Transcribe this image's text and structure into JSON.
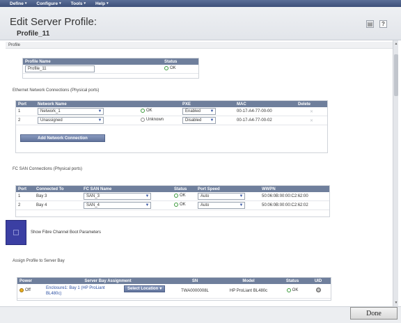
{
  "menu": [
    {
      "label": "Define"
    },
    {
      "label": "Configure"
    },
    {
      "label": "Tools"
    },
    {
      "label": "Help"
    }
  ],
  "header": {
    "title": "Edit Server Profile:",
    "subtitle": "Profile_11"
  },
  "profile": {
    "section_title": "Profile",
    "col_name": "Profile Name",
    "col_status": "Status",
    "name_value": "Profile_11",
    "status": "OK"
  },
  "ethernet": {
    "section_title": "Ethernet Network Connections (Physical ports)",
    "headers": {
      "port": "Port",
      "network": "Network Name",
      "pxe": "PXE",
      "mac": "MAC",
      "delete": "Delete"
    },
    "rows": [
      {
        "port": "1",
        "network": "Network_1",
        "status": "OK",
        "pxe": "Enabled",
        "mac": "00-17-A4-77-00-00"
      },
      {
        "port": "2",
        "network": "Unassigned",
        "status": "Unknown",
        "pxe": "Disabled",
        "mac": "00-17-A4-77-00-02"
      }
    ],
    "add_button": "Add Network Connection"
  },
  "fcsan": {
    "section_title": "FC SAN Connections (Physical ports)",
    "headers": {
      "port": "Port",
      "connected": "Connected To",
      "san": "FC SAN Name",
      "status": "Status",
      "speed": "Port Speed",
      "wwpn": "WWPN"
    },
    "rows": [
      {
        "port": "1",
        "connected": "Bay 3",
        "san": "SAN_3",
        "status": "OK",
        "speed": "Auto",
        "wwpn": "50:06:0B:00:00:C2:62:00"
      },
      {
        "port": "2",
        "connected": "Bay 4",
        "san": "SAN_4",
        "status": "OK",
        "speed": "Auto",
        "wwpn": "50:06:0B:00:00:C2:62:02"
      }
    ]
  },
  "boot": {
    "label": "Show Fibre Channel Boot Parameters"
  },
  "assign": {
    "section_title": "Assign Profile to Server Bay",
    "headers": {
      "power": "Power",
      "bay": "Server Bay Assignment",
      "sn": "SN",
      "model": "Model",
      "status": "Status",
      "uid": "UID"
    },
    "row": {
      "power": "Off",
      "bay_line1": "Enclosure1: Bay 1 (HP ProLiant",
      "bay_line2": "BL480c)",
      "select_location": "Select Location",
      "sn": "TWA0000008L",
      "model": "HP ProLiant BL480c",
      "status": "OK"
    }
  },
  "footer": {
    "done_label": "Done"
  }
}
